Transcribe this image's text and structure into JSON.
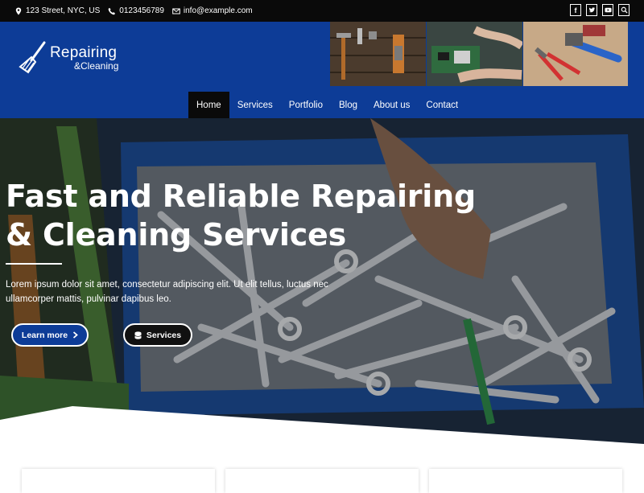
{
  "topbar": {
    "address": "123 Street, NYC, US",
    "phone": "0123456789",
    "email": "info@example.com",
    "social": [
      "facebook-icon",
      "twitter-icon",
      "youtube-icon",
      "search-icon"
    ]
  },
  "header": {
    "logo_line1": "Repairing",
    "logo_line2": "&Cleaning",
    "brand_color": "#0d3c97"
  },
  "nav": {
    "items": [
      "Home",
      "Services",
      "Portfolio",
      "Blog",
      "About us",
      "Contact"
    ],
    "active": "Home"
  },
  "hero": {
    "title_line1": "Fast and Reliable Repairing",
    "title_line2": "& Cleaning Services",
    "text": "Lorem ipsum dolor sit amet, consectetur adipiscing elit. Ut elit tellus, luctus nec ullamcorper mattis, pulvinar dapibus leo.",
    "btn_learn": "Learn more",
    "btn_services": "Services"
  }
}
